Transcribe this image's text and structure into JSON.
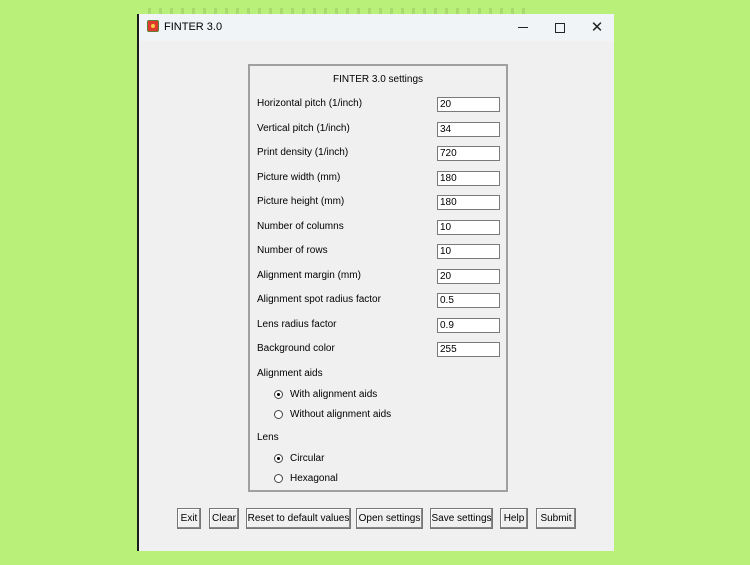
{
  "window": {
    "title": "FINTER 3.0",
    "controls": {
      "minimize_icon": "minimize-icon",
      "maximize_icon": "maximize-icon",
      "close_glyph": "✕"
    }
  },
  "settings": {
    "title": "FINTER 3.0 settings",
    "fields": [
      {
        "label": "Horizontal pitch (1/inch)",
        "value": "20"
      },
      {
        "label": "Vertical pitch (1/inch)",
        "value": "34"
      },
      {
        "label": "Print density (1/inch)",
        "value": "720"
      },
      {
        "label": "Picture width (mm)",
        "value": "180"
      },
      {
        "label": "Picture height (mm)",
        "value": "180"
      },
      {
        "label": "Number of columns",
        "value": "10"
      },
      {
        "label": "Number of rows",
        "value": "10"
      },
      {
        "label": "Alignment margin (mm)",
        "value": "20"
      },
      {
        "label": "Alignment spot radius factor",
        "value": "0.5"
      },
      {
        "label": "Lens radius factor",
        "value": "0.9"
      },
      {
        "label": "Background color",
        "value": "255"
      }
    ],
    "alignment_aids": {
      "label": "Alignment aids",
      "options": [
        {
          "label": "With alignment aids",
          "selected": true
        },
        {
          "label": "Without alignment aids",
          "selected": false
        }
      ]
    },
    "lens": {
      "label": "Lens",
      "options": [
        {
          "label": "Circular",
          "selected": true
        },
        {
          "label": "Hexagonal",
          "selected": false
        }
      ]
    }
  },
  "buttons": {
    "exit": "Exit",
    "clear": "Clear",
    "reset": "Reset to default values",
    "open": "Open settings",
    "save": "Save settings",
    "help": "Help",
    "submit": "Submit"
  },
  "colors": {
    "desktop": "#b9f079",
    "window_bg": "#f0f0f0",
    "titlebar_bg": "#f0f4f6"
  }
}
